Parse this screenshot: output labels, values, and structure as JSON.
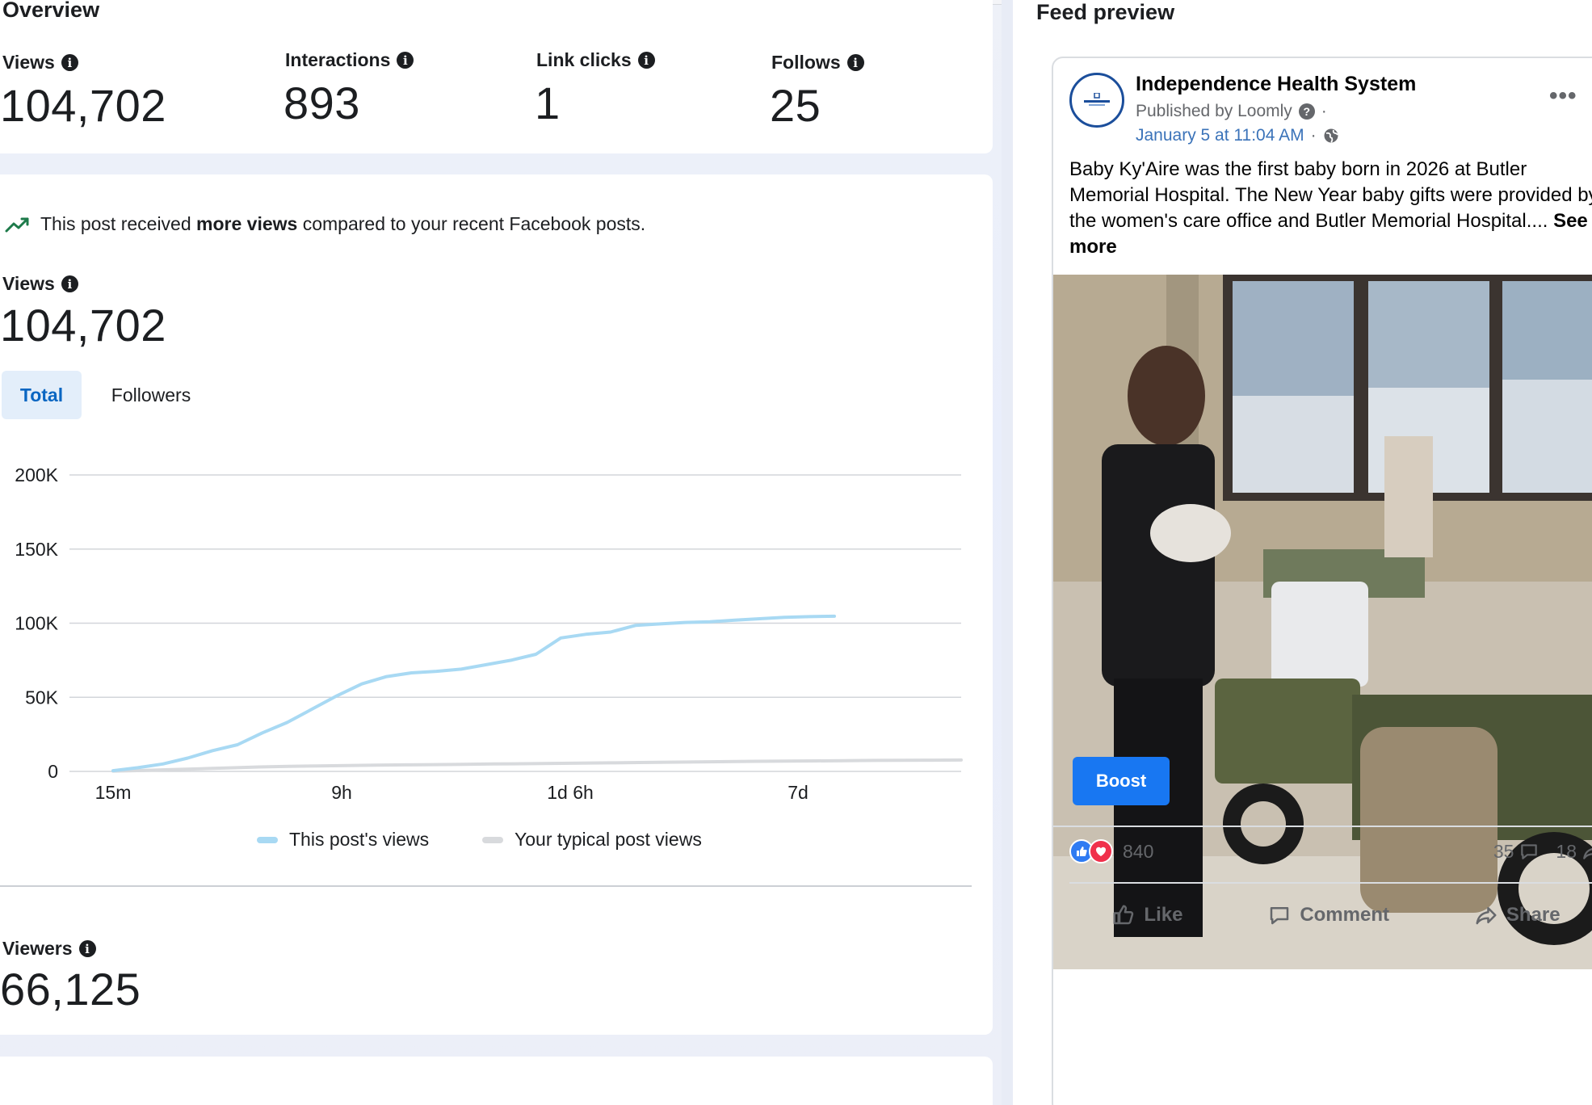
{
  "overview": {
    "title": "Overview",
    "metrics": [
      {
        "label": "Views",
        "value": "104,702"
      },
      {
        "label": "Interactions",
        "value": "893"
      },
      {
        "label": "Link clicks",
        "value": "1"
      },
      {
        "label": "Follows",
        "value": "25"
      }
    ]
  },
  "views_card": {
    "insight_prefix": "This post received",
    "insight_bold": "more views",
    "insight_suffix": "compared to your recent Facebook posts.",
    "views_label": "Views",
    "views_value": "104,702",
    "tabs": [
      {
        "label": "Total",
        "selected": true
      },
      {
        "label": "Followers",
        "selected": false
      }
    ],
    "viewers_label": "Viewers",
    "viewers_value": "66,125"
  },
  "chart_data": {
    "type": "line",
    "title": "",
    "xlabel": "",
    "ylabel": "",
    "x_tick_labels": [
      "15m",
      "9h",
      "1d 6h",
      "7d"
    ],
    "y_tick_labels": [
      "0",
      "50K",
      "100K",
      "150K",
      "200K"
    ],
    "ylim": [
      0,
      200000
    ],
    "grid": true,
    "legend_position": "bottom",
    "x_points": 30,
    "series": [
      {
        "name": "This post's views",
        "color": "#a8d9f3",
        "values": [
          500,
          2500,
          5000,
          9000,
          14000,
          18000,
          26000,
          33000,
          42000,
          51000,
          59000,
          64000,
          66500,
          67500,
          69000,
          72000,
          75000,
          79000,
          90000,
          92500,
          94000,
          98500,
          99500,
          100500,
          101000,
          102000,
          103000,
          104000,
          104400,
          104702
        ]
      },
      {
        "name": "Your typical post views",
        "color": "#d8dadd",
        "values": [
          200,
          600,
          1200,
          1800,
          2400,
          3000,
          3400,
          3700,
          4000,
          4200,
          4400,
          4600,
          4800,
          5000,
          5200,
          5400,
          5600,
          5800,
          6000,
          6200,
          6400,
          6600,
          6800,
          6950,
          7100,
          7250,
          7400,
          7500,
          7600,
          7700
        ]
      }
    ]
  },
  "feed": {
    "title": "Feed preview",
    "page_name": "Independence Health System",
    "published_by": "Published by Loomly",
    "date": "January 5 at 11:04 AM",
    "text": "Baby Ky'Aire was the first baby born in 2026 at Butler Memorial Hospital. The New Year baby gifts were provided by the women's care office and Butler Memorial Hospital....",
    "see_more": "See more",
    "boost_label": "Boost",
    "reactions_count": "840",
    "comments_count": "35",
    "shares_count": "18",
    "actions": {
      "like": "Like",
      "comment": "Comment",
      "share": "Share"
    }
  },
  "colors": {
    "accent": "#0a66c2",
    "boost": "#1877f2",
    "this_post_line": "#a8d9f3",
    "typical_line": "#d8dadd"
  },
  "icons": [
    "info-icon",
    "trend-up-icon",
    "question-icon",
    "globe-icon",
    "more-icon",
    "like-reaction-icon",
    "love-reaction-icon",
    "comment-icon",
    "share-icon",
    "like-icon"
  ]
}
